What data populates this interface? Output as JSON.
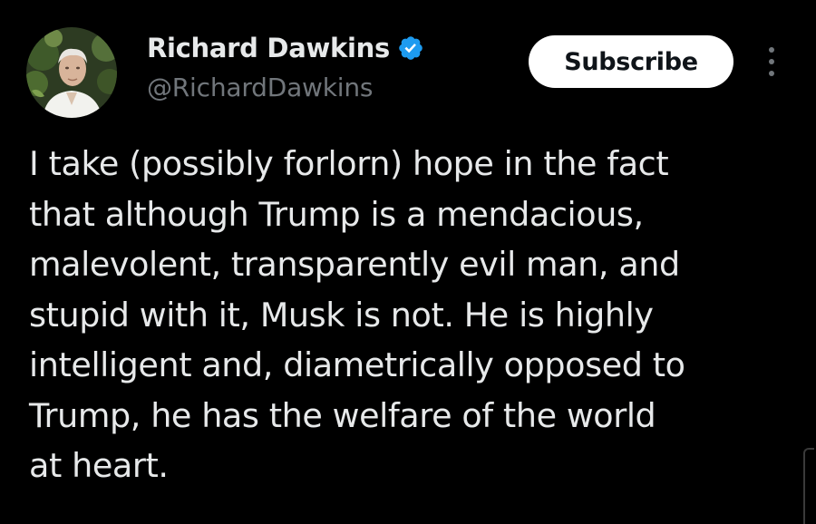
{
  "author": {
    "display_name": "Richard Dawkins",
    "handle": "@RichardDawkins",
    "verified_icon": "verified-badge-icon",
    "avatar_icon": "avatar-photo"
  },
  "actions": {
    "subscribe_label": "Subscribe",
    "more_icon": "more-vertical-icon"
  },
  "tweet": {
    "text": "I take  (possibly forlorn) hope in the fact\nthat although Trump is a mendacious,\nmalevolent,  transparently evil man, and\nstupid with it, Musk is not. He is highly\nintelligent and, diametrically opposed to\nTrump, he has the welfare of the world\nat heart."
  },
  "colors": {
    "background": "#000000",
    "text_primary": "#e7e9ea",
    "text_secondary": "#71767b",
    "verified_blue": "#1d9bf0",
    "button_bg": "#ffffff"
  }
}
